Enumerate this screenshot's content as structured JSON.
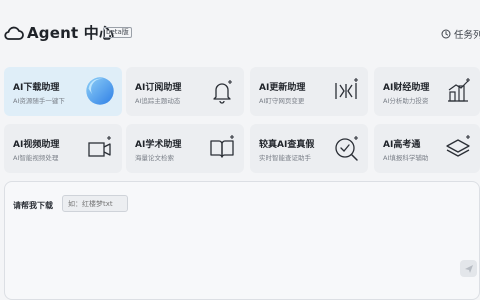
{
  "header": {
    "brand": "Agent 中心",
    "badge": "beta版",
    "task_list_label": "任务列",
    "logo_icon": "cloud-logo-icon",
    "task_icon": "clock-icon"
  },
  "cards": [
    {
      "title": "AI下载助理",
      "desc": "AI资源随手一键下",
      "icon": "download-blob-icon",
      "active": true
    },
    {
      "title": "AI订阅助理",
      "desc": "AI追踪主题动态",
      "icon": "bell-icon",
      "active": false
    },
    {
      "title": "AI更新助理",
      "desc": "AI盯守网页变更",
      "icon": "update-bars-icon",
      "active": false
    },
    {
      "title": "AI财经助理",
      "desc": "AI分析助力投资",
      "icon": "finance-chart-icon",
      "active": false
    },
    {
      "title": "AI视频助理",
      "desc": "AI智能视频处理",
      "icon": "video-icon",
      "active": false
    },
    {
      "title": "AI学术助理",
      "desc": "海量论文检索",
      "icon": "book-icon",
      "active": false
    },
    {
      "title": "较真AI查真假",
      "desc": "实时智能查证助手",
      "icon": "verify-check-icon",
      "active": false
    },
    {
      "title": "AI高考通",
      "desc": "AI填报科学辅助",
      "icon": "layers-icon",
      "active": false
    }
  ],
  "prompt": {
    "label": "请帮我下载",
    "placeholder": "如：红楼梦txt",
    "send_icon": "send-icon"
  },
  "colors": {
    "active_card_bg": "#dfeef8",
    "card_bg": "#eceef1",
    "accent_blue": "#3d8fe8"
  }
}
